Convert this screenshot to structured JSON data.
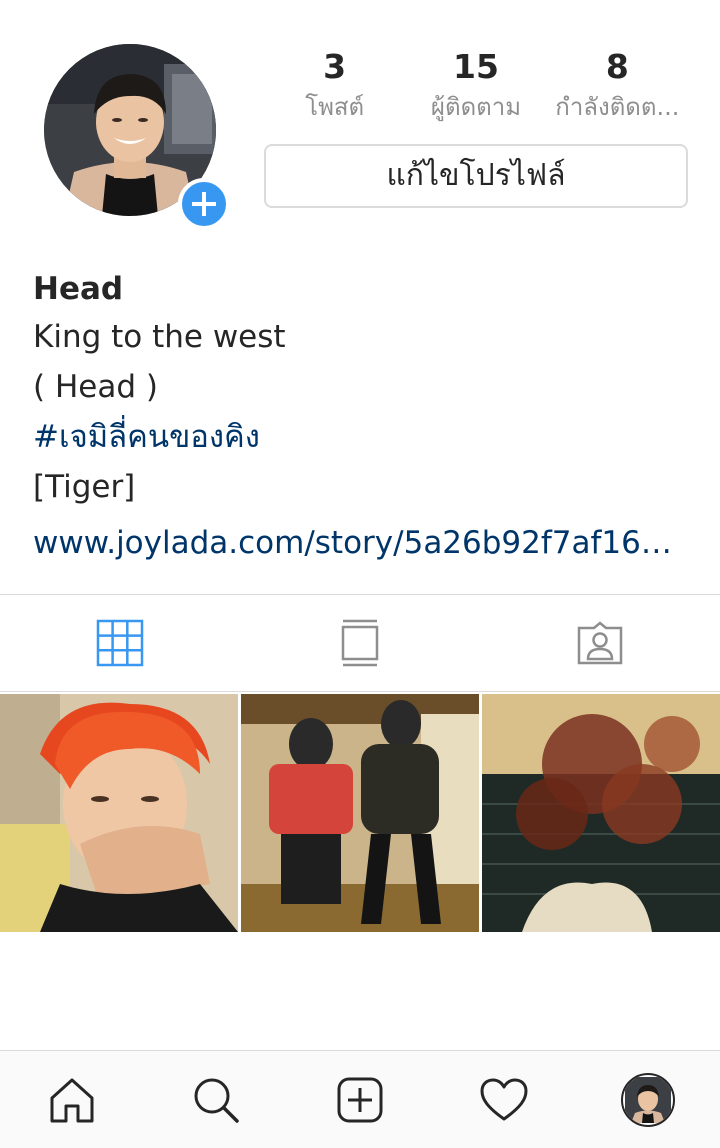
{
  "profile": {
    "stats": [
      {
        "count": "3",
        "label": "โพสต์"
      },
      {
        "count": "15",
        "label": "ผู้ติดตาม"
      },
      {
        "count": "8",
        "label": "กำลังติดต..."
      }
    ],
    "edit_label": "แก้ไขโปรไฟล์"
  },
  "bio": {
    "name": "Head",
    "line1": "King to the west",
    "line2": " ( Head )",
    "hashtag": "#เจมิลี่คนของคิง",
    "line3": "[Tiger]",
    "link": "www.joylada.com/story/5a26b92f7af16…"
  },
  "tabs": [
    {
      "icon": "grid-icon",
      "active": true
    },
    {
      "icon": "feed-list-icon",
      "active": false
    },
    {
      "icon": "tagged-user-icon",
      "active": false
    }
  ],
  "nav": [
    {
      "icon": "home-icon"
    },
    {
      "icon": "search-icon"
    },
    {
      "icon": "new-post-icon"
    },
    {
      "icon": "heart-icon"
    },
    {
      "icon": "profile-avatar-icon"
    }
  ],
  "colors": {
    "accent": "#3897f0",
    "link": "#003569",
    "text": "#262626",
    "muted": "#8e8e8e",
    "border": "#dbdbdb"
  }
}
